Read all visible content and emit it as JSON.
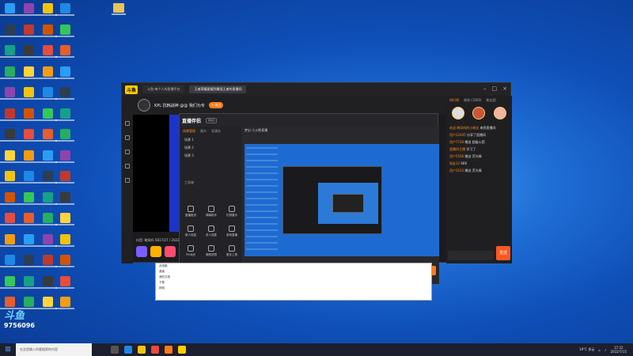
{
  "desktop": {
    "icon_colors": [
      "#2a9df4",
      "#ffd43b",
      "#e85d2a",
      "#3a3a3a",
      "#34c759",
      "#c0392b",
      "#1e88e5",
      "#8e44ad",
      "#f39c12",
      "#27ae60",
      "#e74c3c",
      "#16a085",
      "#d35400",
      "#2c3e50",
      "#f1c40f"
    ],
    "watermark_line1": "斗鱼",
    "watermark_line2": "9756096"
  },
  "app": {
    "logo": "斗鱼",
    "tabs": [
      "斗鱼-每个人的直播平台",
      "王者荣耀星耀到最强王者的直播间"
    ],
    "channel": {
      "title": "KPL 抗韩战神 @@ 我们为专",
      "pill": "+ 关注"
    },
    "stream_info": "抖音: 晓风吗   5817/27 / 2022",
    "chat": {
      "tabs": [
        "排行榜",
        "贵宾 (1000)",
        "粉丝团"
      ],
      "messages": [
        {
          "user": "欢迎 晓风吗的小粉丝",
          "text": "来到直播间"
        },
        {
          "user": "用户12445",
          "text": "分享了直播间"
        },
        {
          "user": "用户7720",
          "text": "赠送 超级火箭"
        },
        {
          "user": "直播间主播",
          "text": "学习了"
        },
        {
          "user": "用户5566",
          "text": "赠送 荧光棒"
        },
        {
          "user": "网友12",
          "text": "666"
        },
        {
          "user": "用户3212",
          "text": "赠送 荧光棒"
        }
      ],
      "send": "发送"
    }
  },
  "obs": {
    "logo": "直播伴侣",
    "version": "PRO",
    "scene_header": [
      "场景管理",
      "观众",
      "导演台"
    ],
    "scenes": [
      "场景 1",
      "场景 2",
      "场景 3"
    ],
    "head_title": "梦幻 小火熊直播",
    "section": "工具箱",
    "tools": [
      "直播推流",
      "弹幕助手",
      "礼物展示",
      "新人欢迎",
      "多人连麦",
      "游戏直播",
      "PK对战",
      "美颜滤镜",
      "更多工具"
    ],
    "bottom_buttons": [
      "直播设置",
      "画中画",
      "音乐",
      "礼物",
      "视频",
      "开始直播",
      "高清画质"
    ],
    "go_live": "开始直播"
  },
  "explorer": {
    "rows": [
      "此电脑",
      "桌面",
      "我的文档",
      "下载",
      "网络"
    ]
  },
  "taskbar": {
    "search_placeholder": "在这里输入你要搜索的内容",
    "weather": "19°C 多云",
    "time": "17:32",
    "date": "2022/7/15"
  }
}
